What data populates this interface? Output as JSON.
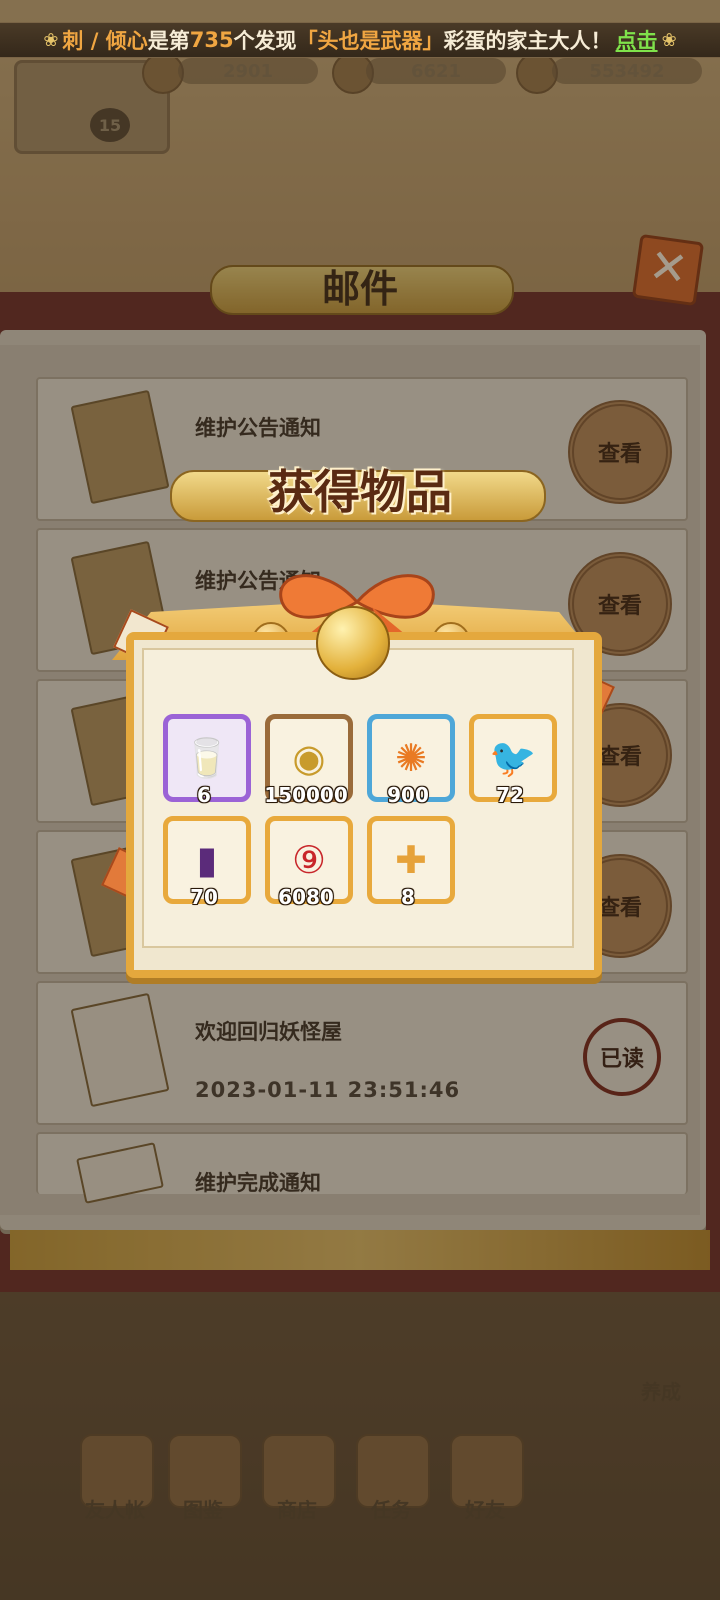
{
  "marquee": {
    "prefix": "刺 / 倾心",
    "text1": "是第",
    "number": "735",
    "text2": "个发现",
    "egg_name": "「头也是武器」",
    "text3": "彩蛋的家主大人！",
    "link": "点击"
  },
  "resources": {
    "res1": "2901",
    "res2": "6621",
    "res3": "553492"
  },
  "player": {
    "level": "15"
  },
  "mail": {
    "title": "邮件",
    "items": [
      {
        "subject": "维护公告通知",
        "action": "查看"
      },
      {
        "subject": "维护公告通知",
        "action": "查看"
      },
      {
        "subject": "",
        "action": "查看"
      },
      {
        "subject": "",
        "action": "查看"
      },
      {
        "subject": "欢迎回归妖怪屋",
        "date": "2023-01-11 23:51:46",
        "status": "已读"
      },
      {
        "subject": "维护完成通知"
      }
    ]
  },
  "reward": {
    "title": "获得物品",
    "items": [
      {
        "icon": "milk-carton-icon",
        "qty": "6",
        "frame": "purple"
      },
      {
        "icon": "coin-icon",
        "qty": "150000",
        "frame": "bronze"
      },
      {
        "icon": "flame-orb-icon",
        "qty": "900",
        "frame": "blue"
      },
      {
        "icon": "bird-icon",
        "qty": "72",
        "frame": "gold"
      },
      {
        "icon": "card-icon",
        "qty": "70",
        "frame": "gold"
      },
      {
        "icon": "magatama-icon",
        "qty": "6080",
        "frame": "gold"
      },
      {
        "icon": "food-plus-icon",
        "qty": "8",
        "frame": "gold"
      }
    ]
  },
  "nav": {
    "items": [
      "友人帐",
      "图鉴",
      "商店",
      "任务",
      "好友"
    ],
    "side": "养成"
  }
}
